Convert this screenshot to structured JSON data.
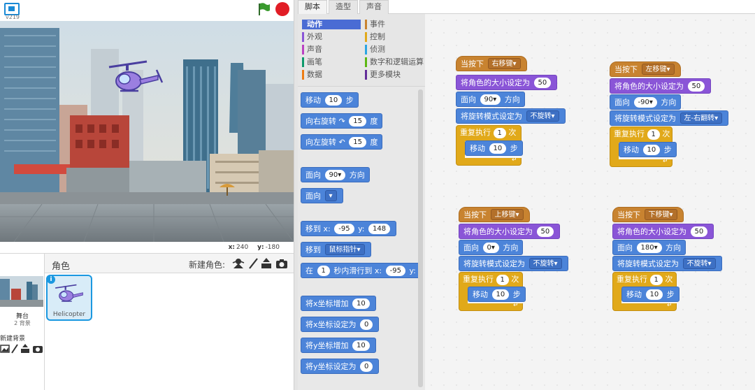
{
  "stage": {
    "version": "v219",
    "coords": {
      "x_label": "x:",
      "x": "240",
      "y_label": "y:",
      "y": "-180"
    }
  },
  "sprites_pane": {
    "title": "角色",
    "new_sprite_label": "新建角色:",
    "stage_name": "舞台",
    "backdrop_count": "2 背景",
    "new_backdrop_label": "新建背景",
    "sprite_name": "Helicopter"
  },
  "tabs": [
    "脚本",
    "造型",
    "声音"
  ],
  "categories": [
    {
      "label": "动作",
      "color": "#4a6cd4"
    },
    {
      "label": "外观",
      "color": "#8a55d7"
    },
    {
      "label": "声音",
      "color": "#bb42c3"
    },
    {
      "label": "画笔",
      "color": "#0e9a6c"
    },
    {
      "label": "数据",
      "color": "#ee7d16"
    },
    {
      "label": "事件",
      "color": "#c88330"
    },
    {
      "label": "控制",
      "color": "#e1a91a"
    },
    {
      "label": "侦测",
      "color": "#2ca5e2"
    },
    {
      "label": "数字和逻辑运算",
      "color": "#5cb712"
    },
    {
      "label": "更多模块",
      "color": "#632d99"
    }
  ],
  "palette": {
    "move": {
      "a": "移动",
      "n": "10",
      "b": "步"
    },
    "turn_right": {
      "a": "向右旋转",
      "n": "15",
      "b": "度"
    },
    "turn_left": {
      "a": "向左旋转",
      "n": "15",
      "b": "度"
    },
    "point_dir": {
      "a": "面向",
      "n": "90",
      "b": "方向"
    },
    "point_towards": {
      "a": "面向"
    },
    "goto_xy": {
      "a": "移到 x:",
      "x": "-95",
      "b": "y:",
      "y": "148"
    },
    "goto": {
      "a": "移到",
      "target": "鼠标指针"
    },
    "glide": {
      "a": "在",
      "n": "1",
      "b": "秒内滑行到 x:",
      "x": "-95",
      "c": "y:"
    },
    "change_x": {
      "a": "将x坐标增加",
      "n": "10"
    },
    "set_x": {
      "a": "将x坐标设定为",
      "n": "0"
    },
    "change_y": {
      "a": "将y坐标增加",
      "n": "10"
    },
    "set_y": {
      "a": "将y坐标设定为",
      "n": "0"
    }
  },
  "scripts": [
    {
      "hat": "当按下",
      "key": "右移键",
      "size_label": "将角色的大小设定为",
      "size": "50",
      "dir_a": "面向",
      "dir": "90",
      "dir_b": "方向",
      "rot_label": "将旋转模式设定为",
      "rot": "不旋转",
      "repeat_label": "重复执行",
      "repeat": "1",
      "repeat_b": "次",
      "move_a": "移动",
      "move": "10",
      "move_b": "步"
    },
    {
      "hat": "当按下",
      "key": "左移键",
      "size_label": "将角色的大小设定为",
      "size": "50",
      "dir_a": "面向",
      "dir": "-90",
      "dir_b": "方向",
      "rot_label": "将旋转模式设定为",
      "rot": "左-右翻转",
      "repeat_label": "重复执行",
      "repeat": "1",
      "repeat_b": "次",
      "move_a": "移动",
      "move": "10",
      "move_b": "步"
    },
    {
      "hat": "当按下",
      "key": "上移键",
      "size_label": "将角色的大小设定为",
      "size": "50",
      "dir_a": "面向",
      "dir": "0",
      "dir_b": "方向",
      "rot_label": "将旋转模式设定为",
      "rot": "不旋转",
      "repeat_label": "重复执行",
      "repeat": "1",
      "repeat_b": "次",
      "move_a": "移动",
      "move": "10",
      "move_b": "步"
    },
    {
      "hat": "当按下",
      "key": "下移键",
      "size_label": "将角色的大小设定为",
      "size": "50",
      "dir_a": "面向",
      "dir": "180",
      "dir_b": "方向",
      "rot_label": "将旋转模式设定为",
      "rot": "不旋转",
      "repeat_label": "重复执行",
      "repeat": "1",
      "repeat_b": "次",
      "move_a": "移动",
      "move": "10",
      "move_b": "步"
    }
  ]
}
